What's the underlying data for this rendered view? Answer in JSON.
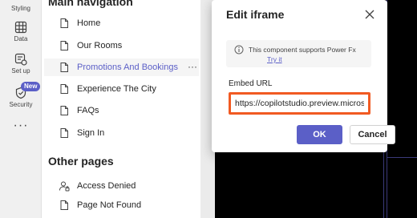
{
  "rail": {
    "styling_label": "Styling",
    "data_label": "Data",
    "setup_label": "Set up",
    "security_label": "Security",
    "new_badge": "New",
    "more": "···"
  },
  "nav": {
    "heading": "Main navigation",
    "items": [
      {
        "label": "Home",
        "icon": "page-icon"
      },
      {
        "label": "Our Rooms",
        "icon": "page-icon"
      },
      {
        "label": "Promotions And Bookings",
        "icon": "page-icon",
        "active": true
      },
      {
        "label": "Experience The City",
        "icon": "page-icon"
      },
      {
        "label": "FAQs",
        "icon": "page-icon"
      },
      {
        "label": "Sign In",
        "icon": "page-icon"
      }
    ],
    "item_more": "···",
    "other_heading": "Other pages",
    "other_items": [
      {
        "label": "Access Denied",
        "icon": "person-lock-icon"
      },
      {
        "label": "Page Not Found",
        "icon": "page-icon"
      }
    ]
  },
  "dialog": {
    "title": "Edit iframe",
    "info_text": "This component supports Power Fx",
    "info_link": "Try it",
    "url_label": "Embed URL",
    "url_value": "https://copilotstudio.preview.microsoft",
    "ok_label": "OK",
    "cancel_label": "Cancel"
  },
  "colors": {
    "accent": "#5b5fc7",
    "highlight_border": "#f15a22",
    "canvas": "#000000"
  }
}
